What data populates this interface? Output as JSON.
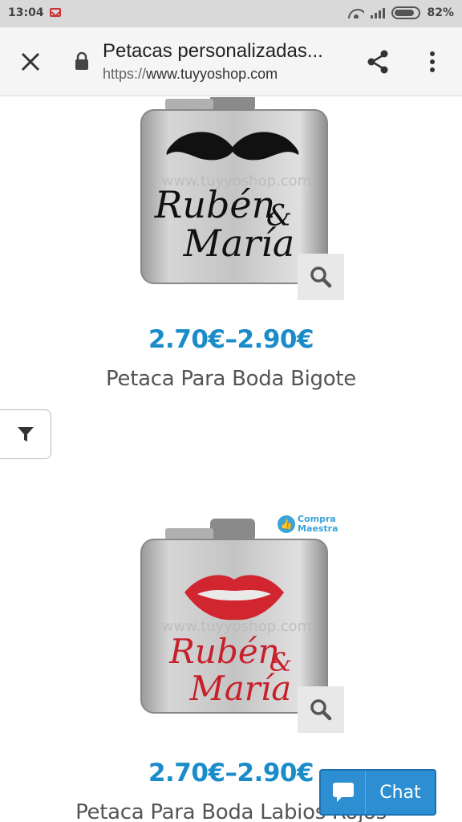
{
  "status_bar": {
    "time": "13:04",
    "battery": "82%"
  },
  "toolbar": {
    "title": "Petacas personalizadas...",
    "url_scheme": "https://",
    "url_host": "www.tuyyoshop.com"
  },
  "products": [
    {
      "price": "2.70€–2.90€",
      "name": "Petaca Para Boda Bigote",
      "engraving_line1": "Rubén",
      "engraving_amp": "&",
      "engraving_line2": "María",
      "watermark": "www.tuyyoshop.com",
      "engraving_color": "#111111"
    },
    {
      "price": "2.70€–2.90€",
      "name": "Petaca Para Boda Labios Rojos",
      "engraving_line1": "Rubén",
      "engraving_amp": "&",
      "engraving_line2": "María",
      "watermark": "www.tuyyoshop.com",
      "engraving_color": "#c8202a",
      "badge_line1": "Compra",
      "badge_line2": "Maestra"
    }
  ],
  "chat": {
    "label": "Chat"
  },
  "colors": {
    "price": "#1a8cc8",
    "chat_bg": "#2d8fd2",
    "lips": "#d12630"
  }
}
